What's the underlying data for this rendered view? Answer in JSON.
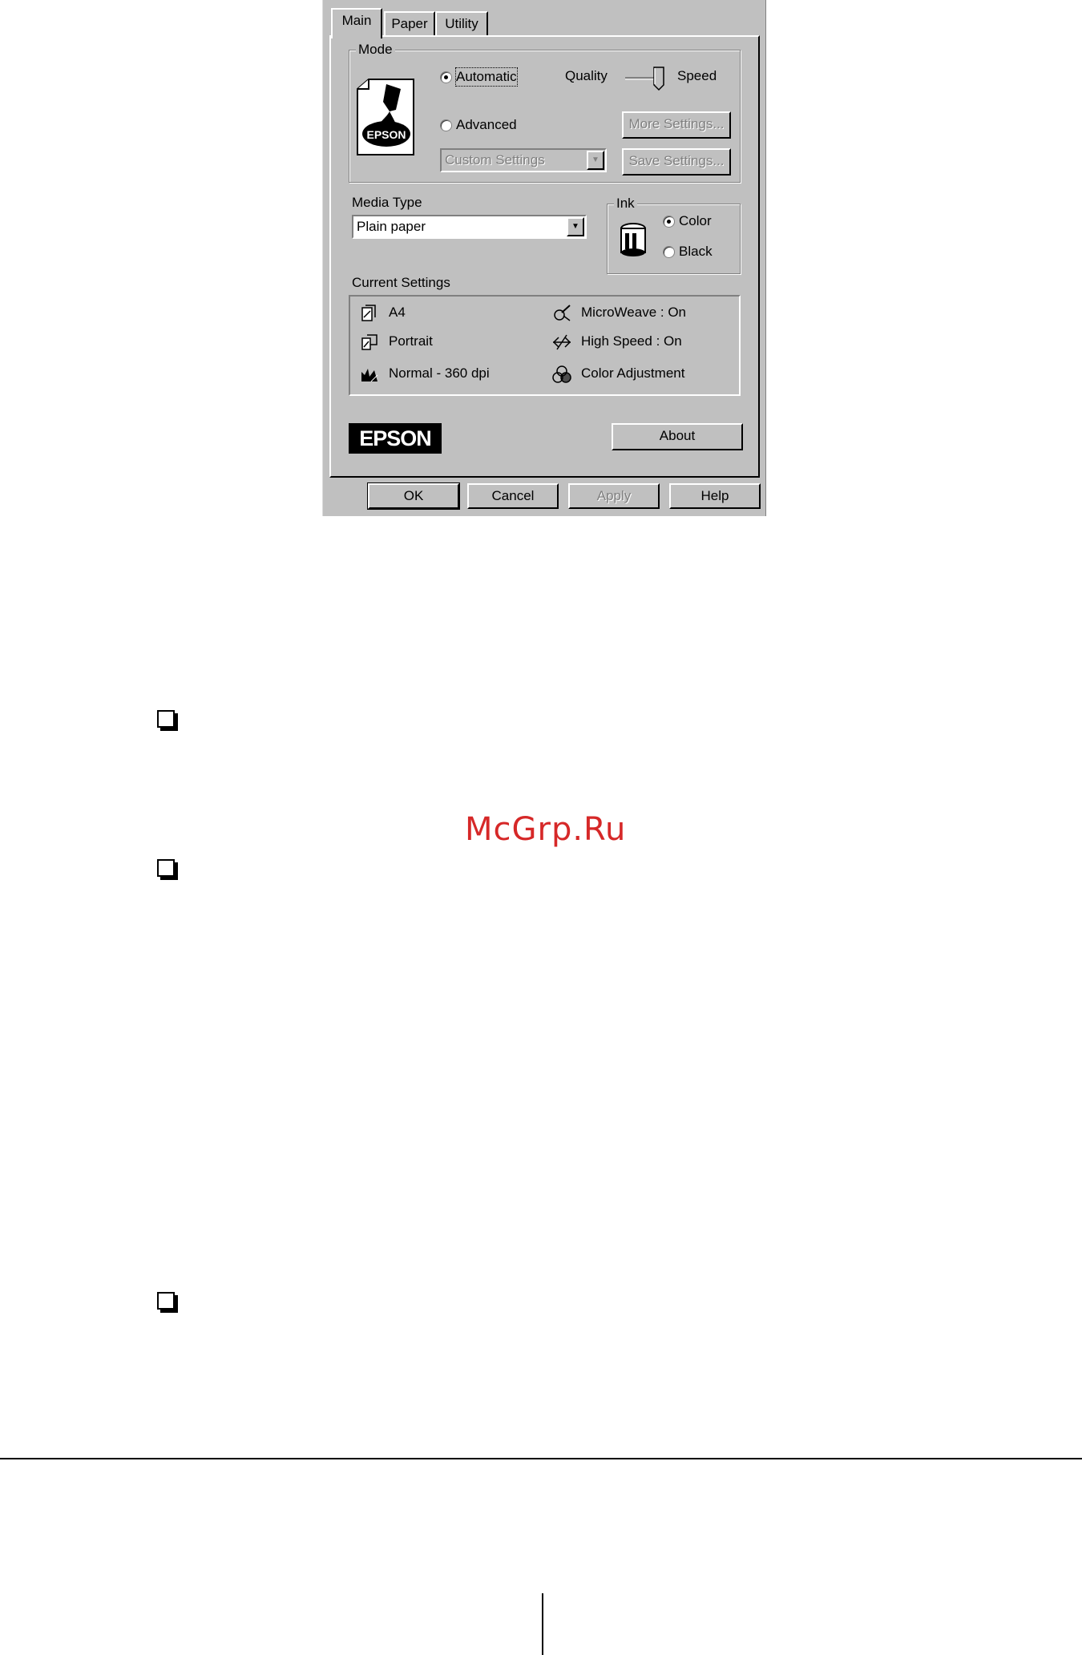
{
  "dialog": {
    "tabs": [
      {
        "label": "Main",
        "active": true
      },
      {
        "label": "Paper",
        "active": false
      },
      {
        "label": "Utility",
        "active": false
      }
    ],
    "mode": {
      "title": "Mode",
      "automatic_label": "Automatic",
      "advanced_label": "Advanced",
      "selected": "Automatic",
      "quality_label": "Quality",
      "speed_label": "Speed",
      "more_settings_label": "More Settings...",
      "save_settings_label": "Save Settings...",
      "custom_settings_value": "Custom Settings",
      "logo_text": "EPSON"
    },
    "media_type": {
      "label": "Media Type",
      "value": "Plain paper"
    },
    "ink": {
      "title": "Ink",
      "color_label": "Color",
      "black_label": "Black",
      "selected": "Color"
    },
    "current_settings": {
      "title": "Current Settings",
      "items": [
        {
          "icon": "paper-size-icon",
          "label": "A4"
        },
        {
          "icon": "microweave-icon",
          "label": "MicroWeave : On"
        },
        {
          "icon": "orientation-icon",
          "label": "Portrait"
        },
        {
          "icon": "high-speed-icon",
          "label": "High Speed : On"
        },
        {
          "icon": "quality-icon",
          "label": "Normal - 360 dpi"
        },
        {
          "icon": "color-adjust-icon",
          "label": "Color Adjustment"
        }
      ]
    },
    "brand_logo": "EPSON",
    "about_label": "About",
    "footer_buttons": {
      "ok": "OK",
      "cancel": "Cancel",
      "apply": "Apply",
      "help": "Help"
    }
  },
  "watermark": "McGrp.Ru"
}
